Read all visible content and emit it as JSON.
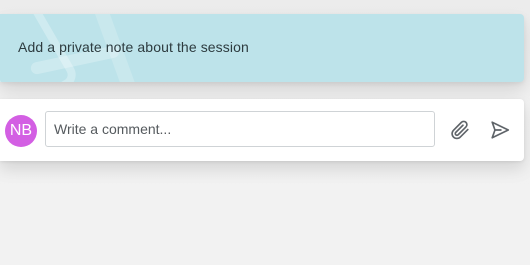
{
  "note": {
    "text": "Add a private note about the session"
  },
  "comment": {
    "avatar_initials": "NB",
    "avatar_color": "#d35fe3",
    "placeholder": "Write a comment...",
    "value": "",
    "attach_icon": "paperclip-icon",
    "send_icon": "send-icon"
  },
  "colors": {
    "note_background": "#bde3ea",
    "page_background": "#f1f1f1"
  }
}
